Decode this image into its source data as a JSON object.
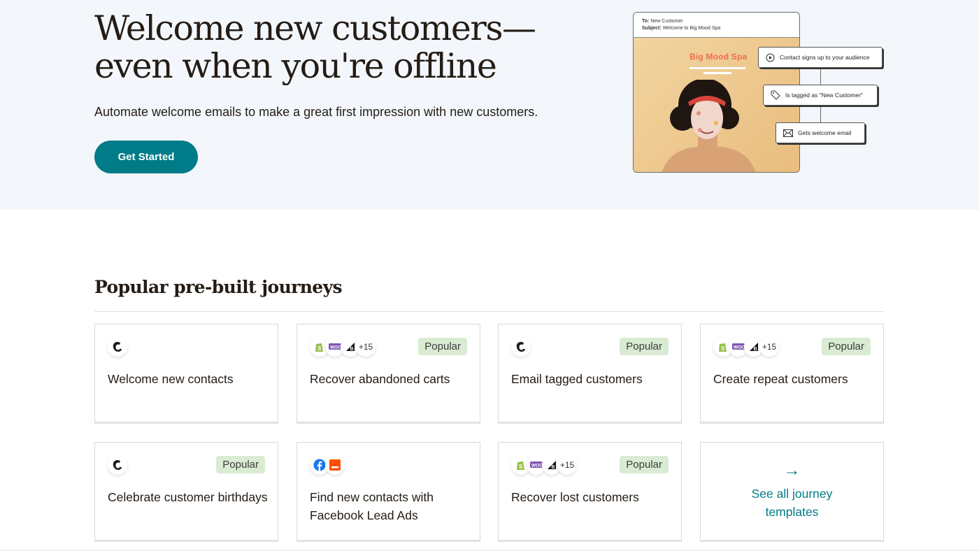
{
  "hero": {
    "title": "Welcome new customers—even when you're offline",
    "subtitle": "Automate welcome emails to make a great first impression with new customers.",
    "cta_label": "Get Started",
    "illustration": {
      "email_to_label": "To:",
      "email_to": "New Customer",
      "email_subject_label": "Subject:",
      "email_subject": "Welcome to Big Mood Spa",
      "brand_name": "Big Mood Spa",
      "steps": [
        {
          "icon": "play-icon",
          "label": "Contact signs up to your audience"
        },
        {
          "icon": "tag-icon",
          "label": "Is tagged as \"New Customer\""
        },
        {
          "icon": "envelope-icon",
          "label": "Gets welcome email"
        }
      ]
    }
  },
  "journeys": {
    "title": "Popular pre-built journeys",
    "cards": [
      {
        "title": "Welcome new contacts",
        "icons": [
          "mailchimp-icon"
        ],
        "badge": null
      },
      {
        "title": "Recover abandoned carts",
        "icons": [
          "shopify-icon",
          "woocommerce-icon",
          "bigcommerce-icon"
        ],
        "more": "+15",
        "badge": "Popular"
      },
      {
        "title": "Email tagged customers",
        "icons": [
          "mailchimp-icon"
        ],
        "badge": "Popular"
      },
      {
        "title": "Create repeat customers",
        "icons": [
          "shopify-icon",
          "woocommerce-icon",
          "bigcommerce-icon"
        ],
        "more": "+15",
        "badge": "Popular"
      },
      {
        "title": "Celebrate customer birthdays",
        "icons": [
          "mailchimp-icon"
        ],
        "badge": "Popular"
      },
      {
        "title": "Find new contacts with Facebook Lead Ads",
        "icons": [
          "facebook-icon",
          "lead-ads-form-icon"
        ],
        "badge": null
      },
      {
        "title": "Recover lost customers",
        "icons": [
          "shopify-icon",
          "woocommerce-icon",
          "bigcommerce-icon"
        ],
        "more": "+15",
        "badge": "Popular"
      }
    ],
    "see_all_label": "See all journey templates",
    "see_all_icon": "arrow-right-icon"
  },
  "colors": {
    "brand_teal": "#007c89",
    "hero_bg": "#f3f7fc",
    "badge_bg": "#d9ebd2",
    "spa_coral": "#f06c4a"
  }
}
